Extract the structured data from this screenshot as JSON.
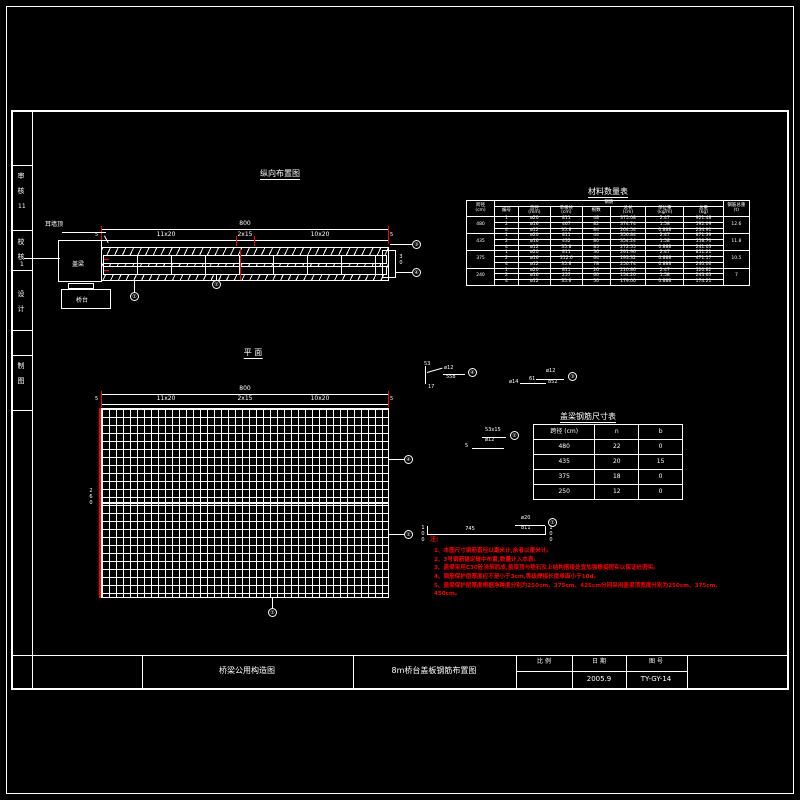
{
  "sheet": {
    "border_color": "#ffffff",
    "background": "#000000",
    "accent_red": "#ff0000"
  },
  "left_margin": {
    "cells": [
      {
        "label": "审 核",
        "sub": "11"
      },
      {
        "label": "校 核",
        "sub": "1"
      },
      {
        "label": "设 计",
        "sub": ""
      },
      {
        "label": "制 图",
        "sub": ""
      }
    ]
  },
  "views": {
    "elevation": {
      "title": "纵向布置图",
      "dims": {
        "total": "800",
        "left": "11x20",
        "mid": "2x15",
        "right": "10x20",
        "edge_left": "5",
        "edge_right": "5",
        "height_label": "30"
      },
      "leaders": [
        "①",
        "②",
        "③",
        "④"
      ],
      "labels": {
        "wing_wall": "耳墙顶",
        "cap": "盖梁",
        "abutment": "桥台"
      }
    },
    "plan": {
      "title": "平  面",
      "dims": {
        "total": "800",
        "left": "11x20",
        "mid": "2x15",
        "right": "10x20",
        "edge_left": "5",
        "edge_right": "5",
        "width_label": "260",
        "bottom_len": "745",
        "bottom_left": "100",
        "bottom_right": "100"
      },
      "leaders": [
        "①",
        "②",
        "③",
        "④"
      ]
    },
    "rebar_callouts": [
      {
        "dia": "ø12",
        "len": "558",
        "mark": "④",
        "note": "53",
        "note2": "17"
      },
      {
        "dia": "ø12",
        "len": "852",
        "mark": "③",
        "note": "ø14",
        "note2": "61"
      },
      {
        "dia": "ø20",
        "len": "811",
        "mark": "①"
      },
      {
        "dia": "ø12",
        "len": "53x15",
        "mark": "②",
        "note": "5"
      }
    ]
  },
  "table_rebar": {
    "title": "材料数量表",
    "header_top": [
      "跨径\n(cm)",
      "钢筋",
      "钢筋总重\n(t)"
    ],
    "header_sub": [
      "编号",
      "直径\n(mm)",
      "单根长\n(cm)",
      "根数",
      "总长\n(cm)",
      "单位重\n(kg/m)",
      "总重\n(kg)"
    ],
    "groups": [
      {
        "span": "480",
        "total": "12.6",
        "rows": [
          {
            "no": "1",
            "dia": "ø20",
            "len": "811",
            "cnt": "48",
            "tot": "375.08",
            "unit": "2.47",
            "wt": "921.48"
          },
          {
            "no": "2",
            "dia": "ø16",
            "len": "467",
            "cnt": "82",
            "tot": "374.74",
            "unit": "1.58",
            "wt": "592.09"
          },
          {
            "no": "4",
            "dia": "ø12",
            "len": "35.8",
            "cnt": "84",
            "tot": "264.54",
            "unit": "0.888",
            "wt": "234.91"
          }
        ]
      },
      {
        "span": "435",
        "total": "11.8",
        "rows": [
          {
            "no": "1",
            "dia": "ø20",
            "len": "811",
            "cnt": "44",
            "tot": "356.84",
            "unit": "2.47",
            "wt": "871.39"
          },
          {
            "no": "2",
            "dia": "ø16",
            "len": "432",
            "cnt": "80",
            "tot": "354.24",
            "unit": "1.58",
            "wt": "558.70"
          },
          {
            "no": "4",
            "dia": "ø12",
            "len": "35.8",
            "cnt": "85",
            "tot": "272.55",
            "unit": "0.888",
            "wt": "241.03"
          }
        ]
      },
      {
        "span": "375",
        "total": "10.5",
        "rows": [
          {
            "no": "1",
            "dia": "ø20",
            "len": "811",
            "cnt": "36",
            "tot": "291.96",
            "unit": "2.47",
            "wt": "851.21"
          },
          {
            "no": "2",
            "dia": "ø16",
            "len": "312.6",
            "cnt": "64",
            "tot": "193.32",
            "unit": "0.888",
            "wt": "471.17"
          },
          {
            "no": "4",
            "dia": "ø12",
            "len": "35.8",
            "cnt": "78",
            "tot": "250.74",
            "unit": "0.888",
            "wt": "240.06"
          }
        ]
      },
      {
        "span": "240",
        "total": "7",
        "rows": [
          {
            "no": "1",
            "dia": "ø20",
            "len": "811",
            "cnt": "26",
            "tot": "210.86",
            "unit": "2.47",
            "wt": "520.82"
          },
          {
            "no": "2",
            "dia": "ø16",
            "len": "257",
            "cnt": "60",
            "tot": "154.20",
            "unit": "1.58",
            "wt": "243.63"
          },
          {
            "no": "4",
            "dia": "ø12",
            "len": "35.8",
            "cnt": "50",
            "tot": "179.00",
            "unit": "0.888",
            "wt": "174.21"
          }
        ]
      }
    ]
  },
  "table_dims": {
    "title": "盖梁钢筋尺寸表",
    "headers": [
      "跨径 (cm)",
      "n",
      "b"
    ],
    "rows": [
      {
        "span": "480",
        "n": "22",
        "b": "0"
      },
      {
        "span": "435",
        "n": "20",
        "b": "15"
      },
      {
        "span": "375",
        "n": "18",
        "b": "0"
      },
      {
        "span": "250",
        "n": "12",
        "b": "0"
      }
    ]
  },
  "notes": {
    "heading": "注:",
    "items": [
      "1、本图尺寸钢筋直径以毫米计,余者以厘米计。",
      "2、3号钢筋锚定缝中布置,数量计入本表。",
      "3、盖梁采用C30砼浇筑而成,盖梁顶与垫石及上结构搭接处宜加强振捣密实以保证砼密实。",
      "4、钢筋保护层厚度应不是小于3cm,等级焊接长度单面小于10d。",
      "5、盖梁保护层厚度根据净跨度分别为250cm、375cm、425cm分别采用盖梁顶宽度分别为250cm、375cm、450cm。"
    ]
  },
  "title_block": {
    "left_cell": "桥梁公用构造图",
    "drawing_name": "8m桥台盖板钢筋布置图",
    "fields": [
      {
        "label": "比  例",
        "value": ""
      },
      {
        "label": "日  期",
        "value": "2005.9"
      },
      {
        "label": "图  号",
        "value": "TY-GY-14"
      }
    ]
  }
}
